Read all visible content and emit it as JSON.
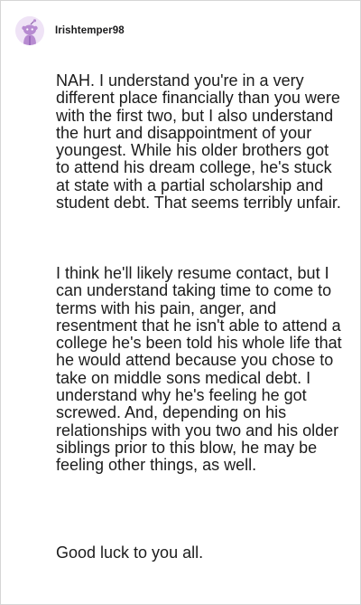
{
  "comment": {
    "username": "Irishtemper98",
    "avatar_icon": "snoo-avatar-icon",
    "avatar_color": "#b78bd1",
    "paragraphs": [
      "NAH. I understand you're in a very different place financially than you were with the first two, but I also understand the hurt and disappointment of your youngest. While his older brothers got to attend his dream college, he's stuck at state with a partial scholarship and student debt. That seems terribly unfair.",
      "I think he'll likely resume contact, but I can understand taking time to come to terms with his pain, anger, and resentment that he isn't able to attend a college he's been told his whole life that he would attend because you chose to take on middle sons medical debt. I understand why he's feeling he got screwed. And, depending on his relationships with you two and his older siblings prior to this blow, he may be feeling other things, as well.",
      "Good luck to you all."
    ]
  }
}
